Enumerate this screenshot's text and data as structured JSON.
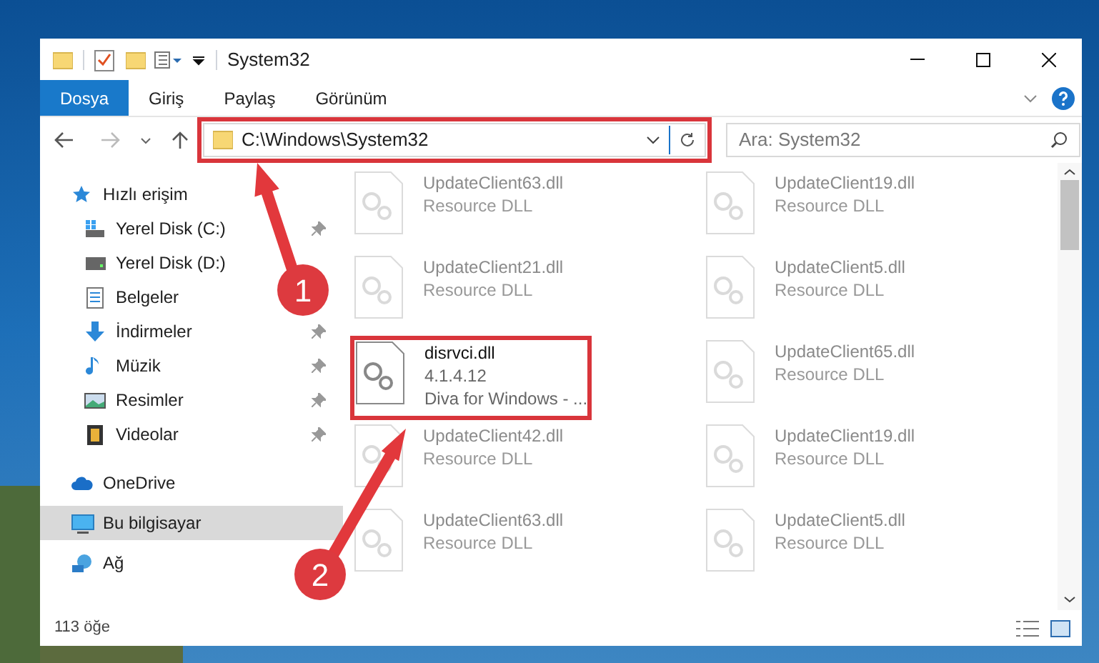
{
  "window": {
    "title": "System32"
  },
  "ribbon_tabs": [
    {
      "label": "Dosya",
      "selected": true
    },
    {
      "label": "Giriş",
      "selected": false
    },
    {
      "label": "Paylaş",
      "selected": false
    },
    {
      "label": "Görünüm",
      "selected": false
    }
  ],
  "address": {
    "path": "C:\\Windows\\System32",
    "highlighted": true
  },
  "search": {
    "placeholder": "Ara: System32"
  },
  "sidebar": {
    "items": [
      {
        "label": "Hızlı erişim",
        "kind": "star",
        "pinned": false,
        "selected": false,
        "children": [
          {
            "label": "Yerel Disk (C:)",
            "kind": "drive-c",
            "pinned": true,
            "selected": false
          },
          {
            "label": "Yerel Disk (D:)",
            "kind": "drive",
            "pinned": false,
            "selected": false
          },
          {
            "label": "Belgeler",
            "kind": "document",
            "pinned": false,
            "selected": false
          },
          {
            "label": "İndirmeler",
            "kind": "download",
            "pinned": true,
            "selected": false
          },
          {
            "label": "Müzik",
            "kind": "music",
            "pinned": true,
            "selected": false
          },
          {
            "label": "Resimler",
            "kind": "picture",
            "pinned": true,
            "selected": false
          },
          {
            "label": "Videolar",
            "kind": "video",
            "pinned": true,
            "selected": false
          }
        ]
      },
      {
        "label": "OneDrive",
        "kind": "cloud",
        "pinned": false,
        "selected": false
      },
      {
        "label": "Bu bilgisayar",
        "kind": "computer",
        "pinned": false,
        "selected": true
      },
      {
        "label": "Ağ",
        "kind": "network",
        "pinned": false,
        "selected": false
      }
    ]
  },
  "files": [
    {
      "name": "UpdateClient63.dll",
      "lines": [
        "Resource DLL"
      ],
      "faded": true,
      "highlighted": false
    },
    {
      "name": "UpdateClient19.dll",
      "lines": [
        "Resource DLL"
      ],
      "faded": true,
      "highlighted": false
    },
    {
      "name": "UpdateClient21.dll",
      "lines": [
        "Resource DLL"
      ],
      "faded": true,
      "highlighted": false
    },
    {
      "name": "UpdateClient5.dll",
      "lines": [
        "Resource DLL"
      ],
      "faded": true,
      "highlighted": false
    },
    {
      "name": "disrvci.dll",
      "lines": [
        "4.1.4.12",
        "Diva for Windows - ..."
      ],
      "faded": false,
      "highlighted": true
    },
    {
      "name": "UpdateClient65.dll",
      "lines": [
        "Resource DLL"
      ],
      "faded": true,
      "highlighted": false
    },
    {
      "name": "UpdateClient42.dll",
      "lines": [
        "Resource DLL"
      ],
      "faded": true,
      "highlighted": false
    },
    {
      "name": "UpdateClient19.dll",
      "lines": [
        "Resource DLL"
      ],
      "faded": true,
      "highlighted": false
    },
    {
      "name": "UpdateClient63.dll",
      "lines": [
        "Resource DLL"
      ],
      "faded": true,
      "highlighted": false
    },
    {
      "name": "UpdateClient5.dll",
      "lines": [
        "Resource DLL"
      ],
      "faded": true,
      "highlighted": false
    }
  ],
  "status_bar": {
    "count": "113 öğe"
  },
  "annotations": [
    {
      "label": "1"
    },
    {
      "label": "2"
    }
  ]
}
